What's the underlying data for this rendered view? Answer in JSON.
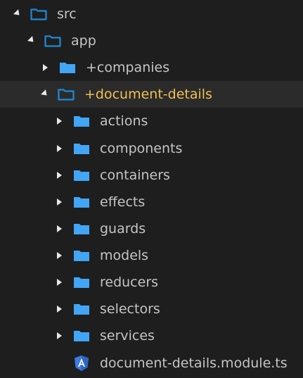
{
  "colors": {
    "background": "#1e1e1f",
    "selected_row": "#2b2b2c",
    "folder_fill": "#42a5f5",
    "folder_outline": "#1f8ad6",
    "text": "#c5c5c5",
    "highlight_text": "#f1c04f",
    "angular_icon": "#3d7be0"
  },
  "tree": {
    "src": "src",
    "app": "app",
    "companies": "+companies",
    "document_details": "+document-details",
    "children": [
      "actions",
      "components",
      "containers",
      "effects",
      "guards",
      "models",
      "reducers",
      "selectors",
      "services"
    ],
    "module_file": "document-details.module.ts"
  }
}
